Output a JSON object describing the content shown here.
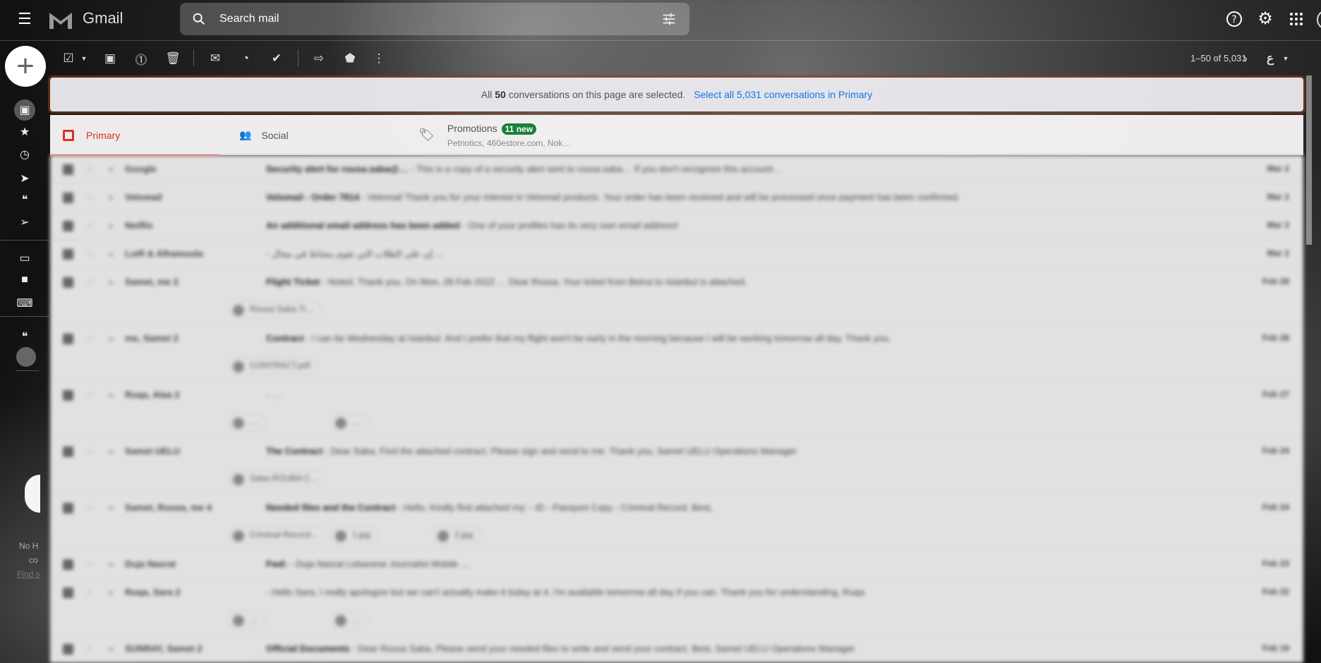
{
  "header": {
    "app_name": "Gmail",
    "search_placeholder": "Search mail",
    "icons": [
      "menu-icon",
      "gmail-logo",
      "search-icon",
      "search-options-icon",
      "help-icon",
      "settings-icon",
      "apps-icon",
      "avatar"
    ]
  },
  "toolbar": {
    "page_info": "1–50 of 5,031",
    "input_tool": "ع",
    "icons": [
      "select-checkbox",
      "archive",
      "report-spam",
      "delete",
      "mark-as-read",
      "snooze",
      "add-to-tasks",
      "move-to",
      "labels",
      "more"
    ]
  },
  "sidebar": {
    "icons": [
      "compose",
      "inbox",
      "starred",
      "snoozed",
      "important",
      "chats",
      "sent",
      "meet-new",
      "meet-join",
      "keyboard",
      "hangouts"
    ],
    "partial_text": [
      "No H",
      "co",
      "Find s"
    ]
  },
  "banner": {
    "prefix": "All",
    "count": "50",
    "suffix": "conversations on this page are selected.",
    "link": "Select all 5,031 conversations in Primary"
  },
  "tabs": [
    {
      "label": "Primary"
    },
    {
      "label": "Social"
    },
    {
      "label": "Promotions",
      "badge": "11 new",
      "sub": "Petriotics, 460estore.com, Nok…"
    }
  ],
  "emails": [
    {
      "sender": "Google",
      "subject": "Security alert for rousa.saba@…",
      "snippet": "This is a copy of a security alert sent to rousa.saba… If you don't recognize this account…",
      "date": "Mar 2"
    },
    {
      "sender": "Velomail",
      "subject": "Velomail - Order 7814",
      "snippet": "Velomail Thank you for your interest in Velomail products. Your order has been received and will be processed once payment has been confirmed.",
      "date": "Mar 2"
    },
    {
      "sender": "Netflix",
      "subject": "An additional email address has been added",
      "snippet": "One of your profiles has its very own email address!",
      "date": "Mar 2"
    },
    {
      "sender": "Lutfi & Alhamoula",
      "subject": "",
      "snippet": "إن على الطلاب التي تقوم بنشاط في مجال ...",
      "date": "Mar 2"
    },
    {
      "sender": "Samet, me 2",
      "subject": "Flight Ticket",
      "snippet": "Noted. Thank you. On Mon, 28 Feb 2022 … Dear Rousa, Your ticket from Beirut to Istanbul is attached.",
      "date": "Feb 28",
      "attachments": [
        "Rousa Saba Ti…"
      ]
    },
    {
      "sender": "me, Samet 2",
      "subject": "Contract",
      "snippet": "I can be Wednesday at Istanbul. And I prefer that my flight won't be early in the morning because I will be working tomorrow all day. Thank you.",
      "date": "Feb 28",
      "attachments": [
        "CONTRACT.pdf"
      ]
    },
    {
      "sender": "Ruqa, Alaa 2",
      "subject": "",
      "snippet": "…",
      "date": "Feb 27",
      "attachments": [
        "…",
        "…"
      ]
    },
    {
      "sender": "Samet UELU",
      "subject": "The Contract",
      "snippet": "Dear Saba, Find the attached contract. Please sign and send to me. Thank you, Samet UELU Operations Manager",
      "date": "Feb 24",
      "attachments": [
        "Saba ROUBA C…"
      ]
    },
    {
      "sender": "Samet, Rousa, me 4",
      "subject": "Needed files and the Contract",
      "snippet": "Hello, Kindly find attached my: - ID - Passport Copy - Criminal Record. Best,",
      "date": "Feb 24",
      "attachments": [
        "Criminal Record…",
        "1.jpg",
        "2.jpg"
      ]
    },
    {
      "sender": "Duja Nasrat",
      "subject": "Fwd:",
      "snippet": "Duja Nasrat Lebanese Journalist Mobile …",
      "date": "Feb 23"
    },
    {
      "sender": "Ruqa, Sara 2",
      "subject": "",
      "snippet": "Hello Sara, I really apologize but we can't actually make it today at 4. I'm available tomorrow all day if you can. Thank you for understanding, Ruqa",
      "date": "Feb 22",
      "attachments": [
        "…",
        "…"
      ]
    },
    {
      "sender": "SUNRAY, Samet 2",
      "subject": "Official Documents",
      "snippet": "Dear Rousa Saba, Please send your needed files to write and send your contract. Best, Samet UELU Operations Manager",
      "date": "Feb 19"
    }
  ]
}
